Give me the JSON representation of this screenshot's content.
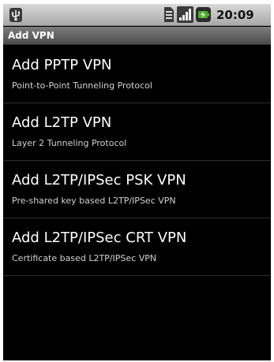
{
  "status_bar": {
    "time": "20:09",
    "icons": [
      "usb-icon",
      "sim-card-icon",
      "signal-icon",
      "battery-charging-icon"
    ]
  },
  "title_bar": {
    "title": "Add VPN"
  },
  "vpn_options": [
    {
      "title": "Add PPTP VPN",
      "subtitle": "Point-to-Point Tunneling Protocol"
    },
    {
      "title": "Add L2TP VPN",
      "subtitle": "Layer 2 Tunneling Protocol"
    },
    {
      "title": "Add L2TP/IPSec PSK VPN",
      "subtitle": "Pre-shared key based L2TP/IPSec VPN"
    },
    {
      "title": "Add L2TP/IPSec CRT VPN",
      "subtitle": "Certificate based L2TP/IPSec VPN"
    }
  ],
  "colors": {
    "background": "#000000",
    "primary_text": "#ffffff",
    "secondary_text": "#d2d2d2",
    "battery_accent": "#4caf2f"
  }
}
